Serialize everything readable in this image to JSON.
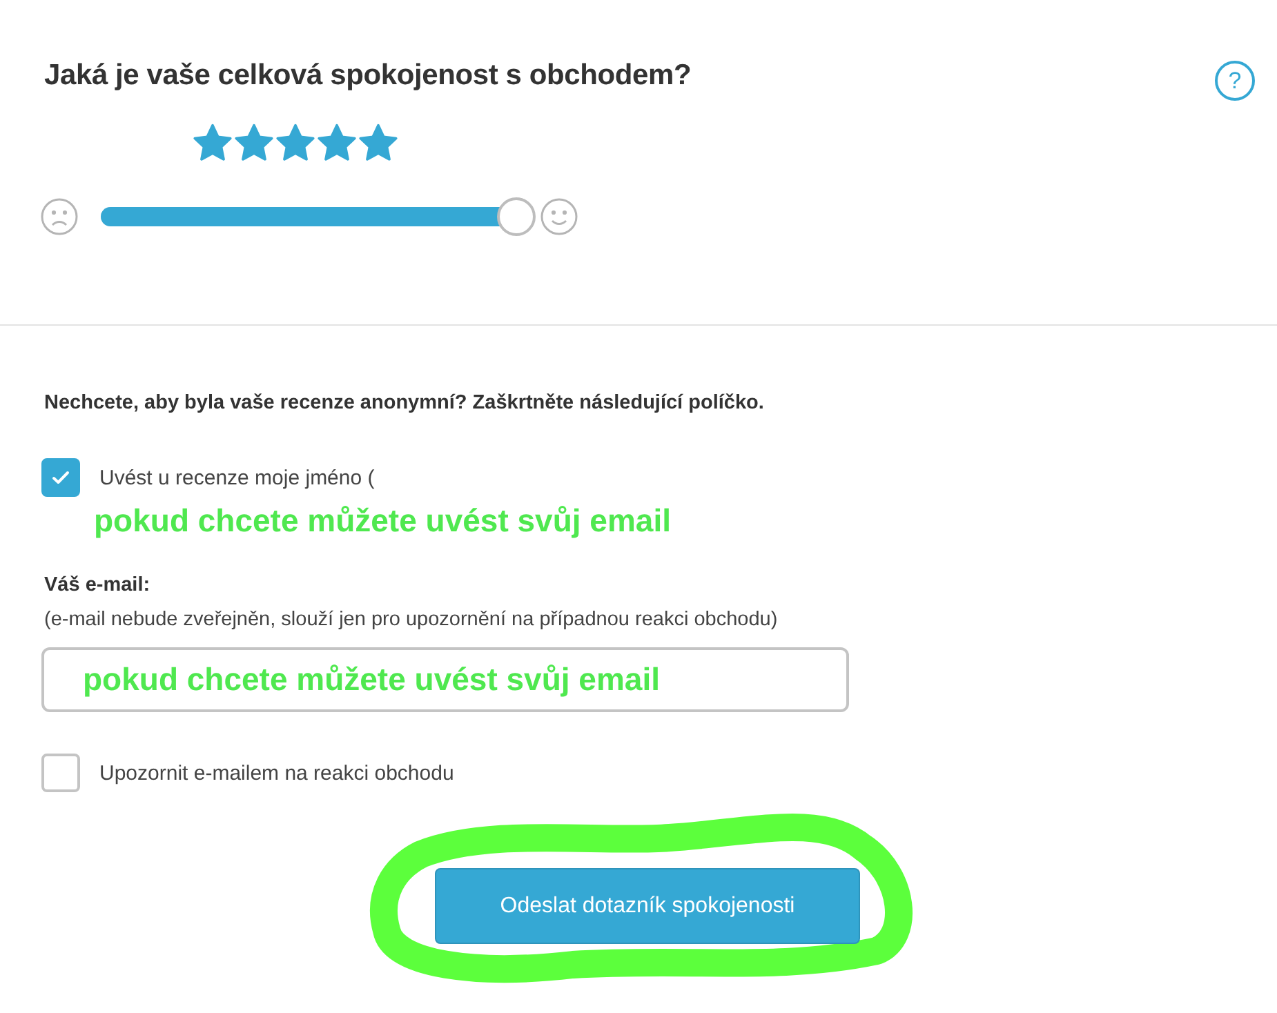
{
  "question": {
    "title": "Jaká je vaše celková spokojenost s obchodem?",
    "help_label": "?",
    "stars": 5,
    "slider": {
      "level": 1.0
    }
  },
  "anonymity": {
    "prompt": "Nechcete, aby byla vaše recenze anonymní? Zaškrtněte následující políčko.",
    "options": [
      {
        "label": "Uvést u recenze moje jméno (",
        "checked": true
      }
    ],
    "annotation": "pokud chcete můžete uvést svůj email"
  },
  "email": {
    "label": "Váš e-mail:",
    "hint": "(e-mail nebude zveřejněn, slouží jen pro upozornění na případnou reakci obchodu)",
    "value": "pokud chcete můžete uvést svůj email"
  },
  "notify": {
    "label": "Upozornit e-mailem na reakci obchodu",
    "checked": false
  },
  "submit": {
    "label": "Odeslat dotazník spokojenosti",
    "highlighted": true
  }
}
